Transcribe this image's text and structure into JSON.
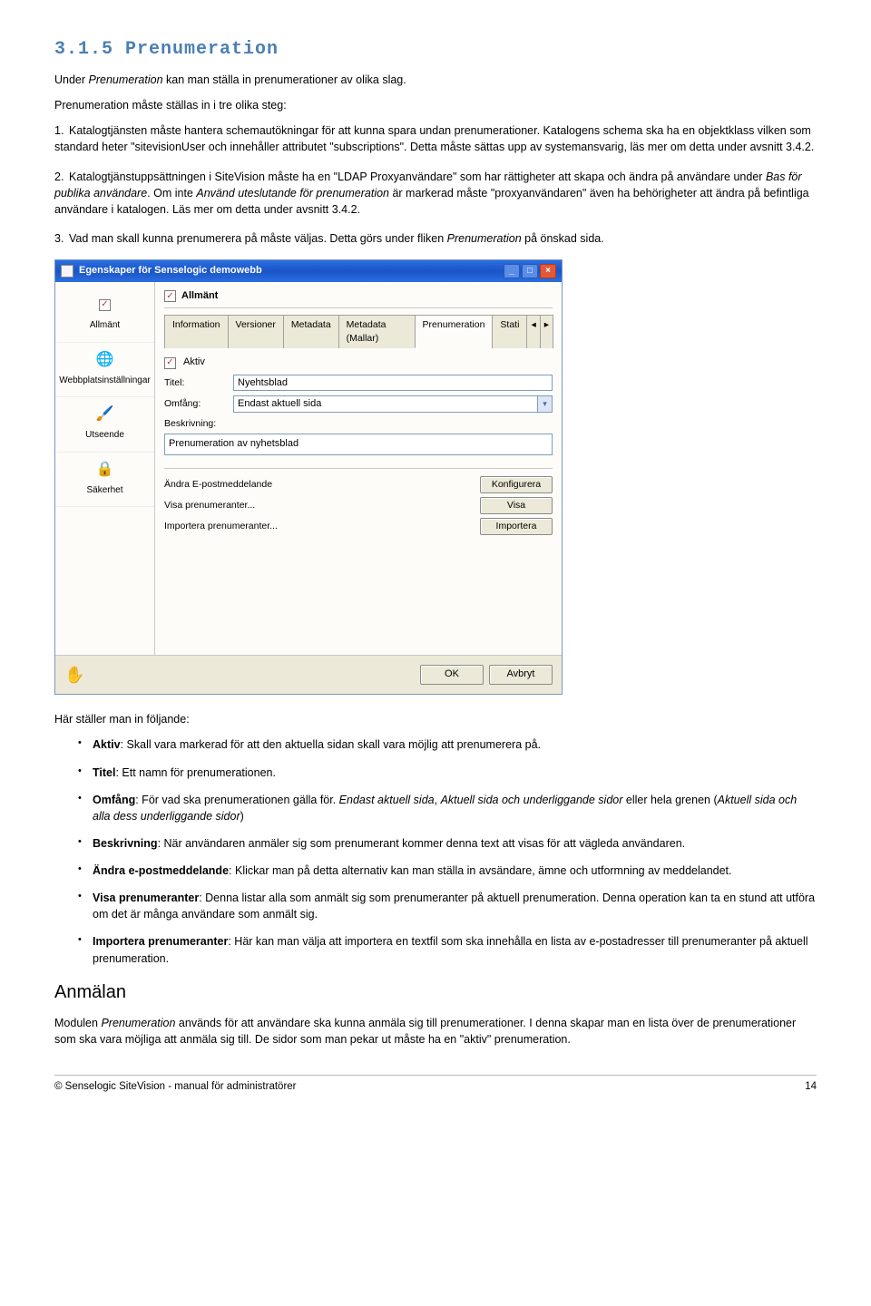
{
  "heading": "3.1.5 Prenumeration",
  "intro1_a": "Under ",
  "intro1_em": "Prenumeration",
  "intro1_b": " kan man ställa in prenumerationer av olika slag.",
  "intro2": "Prenumeration måste ställas in i tre olika steg:",
  "step1": "Katalogtjänsten måste hantera schemautökningar för att kunna spara undan prenumerationer. Katalogens schema ska ha en objektklass vilken som standard heter \"sitevisionUser och innehåller attributet \"subscriptions\". Detta måste sättas upp av systemansvarig, läs mer om detta under avsnitt 3.4.2.",
  "step2_a": "Katalogtjänstuppsättningen i SiteVision måste ha en \"LDAP Proxyanvändare\" som har rättigheter att skapa och ändra på användare under ",
  "step2_em1": "Bas för publika användare",
  "step2_b": ". Om inte ",
  "step2_em2": "Använd uteslutande för prenumeration",
  "step2_c": " är markerad måste \"proxyanvändaren\" även ha behörigheter att ändra på befintliga användare i katalogen. Läs mer om detta under avsnitt 3.4.2.",
  "step3_a": "Vad man skall kunna prenumerera på måste väljas. Detta görs under fliken ",
  "step3_em": "Prenumeration",
  "step3_b": " på önskad sida.",
  "screenshot": {
    "title": "Egenskaper för Senselogic demowebb",
    "sidebar": {
      "items": [
        {
          "label": "Allmänt"
        },
        {
          "label": "Webbplatsinställningar"
        },
        {
          "label": "Utseende"
        },
        {
          "label": "Säkerhet"
        }
      ]
    },
    "main": {
      "title": "Allmänt",
      "tabs": [
        "Information",
        "Versioner",
        "Metadata",
        "Metadata (Mallar)",
        "Prenumeration",
        "Stati"
      ],
      "aktiv_label": "Aktiv",
      "titel_label": "Titel:",
      "titel_value": "Nyehtsblad",
      "omfang_label": "Omfång:",
      "omfang_value": "Endast aktuell sida",
      "beskrivning_label": "Beskrivning:",
      "beskrivning_value": "Prenumeration av nyhetsblad",
      "actions": [
        {
          "label": "Ändra E-postmeddelande",
          "btn": "Konfigurera"
        },
        {
          "label": "Visa prenumeranter...",
          "btn": "Visa"
        },
        {
          "label": "Importera prenumeranter...",
          "btn": "Importera"
        }
      ],
      "ok": "OK",
      "cancel": "Avbryt"
    }
  },
  "after_ss": "Här ställer man in följande:",
  "bullets": {
    "aktiv_b": "Aktiv",
    "aktiv_t": ": Skall vara markerad för att den aktuella sidan skall vara möjlig att prenumerera på.",
    "titel_b": "Titel",
    "titel_t": ": Ett namn för prenumerationen.",
    "omfang_b": "Omfång",
    "omfang_t1": ": För vad ska prenumerationen gälla för. ",
    "omfang_em1": "Endast aktuell sida",
    "omfang_t2": ", ",
    "omfang_em2": "Aktuell sida och underliggande sidor",
    "omfang_t3": " eller hela grenen (",
    "omfang_em3": "Aktuell sida och alla dess underliggande sidor",
    "omfang_t4": ")",
    "besk_b": "Beskrivning",
    "besk_t": ": När användaren anmäler sig som prenumerant kommer denna text att visas för att vägleda användaren.",
    "andra_b": "Ändra e-postmeddelande",
    "andra_t": ": Klickar man på detta alternativ kan man ställa in avsändare, ämne och utformning av meddelandet.",
    "visa_b": "Visa prenumeranter",
    "visa_t": ": Denna listar alla som anmält sig som prenumeranter på aktuell prenumeration. Denna operation kan ta en stund att utföra om det är många användare som anmält sig.",
    "imp_b": "Importera prenumeranter",
    "imp_t": ": Här kan man välja att importera en textfil som ska innehålla en lista av e-postadresser till prenumeranter på aktuell prenumeration."
  },
  "anmalan_heading": "Anmälan",
  "anmalan_p_a": "Modulen ",
  "anmalan_p_em": "Prenumeration",
  "anmalan_p_b": " används för att användare ska kunna anmäla sig till prenumerationer. I denna skapar man en lista över de prenumerationer som ska vara möjliga att anmäla sig till. De sidor som man pekar ut måste ha en \"aktiv\" prenumeration.",
  "footer_left": "© Senselogic SiteVision - manual för administratörer",
  "footer_right": "14"
}
